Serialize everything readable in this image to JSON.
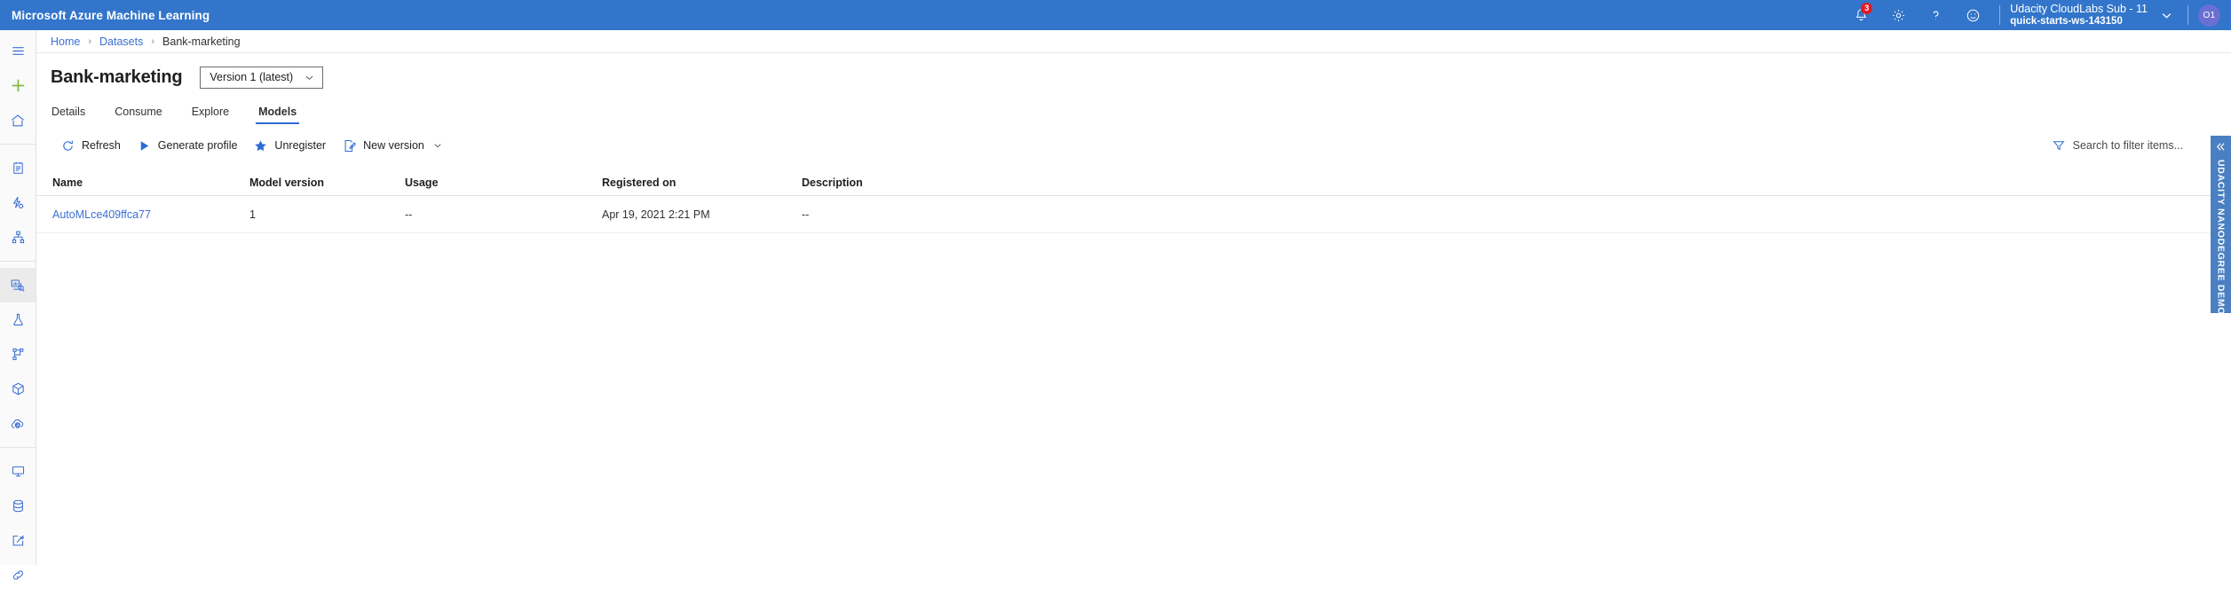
{
  "topbar": {
    "brand": "Microsoft Azure Machine Learning",
    "notifications_badge": "3",
    "icons": [
      "bell-icon",
      "gear-icon",
      "help-icon",
      "feedback-icon"
    ],
    "account": {
      "subscription": "Udacity CloudLabs Sub - 11",
      "workspace": "quick-starts-ws-143150",
      "avatar_initials": "O1"
    },
    "accent_color": "#3275ca"
  },
  "sidebar": {
    "groups": [
      {
        "items": [
          {
            "name": "hamburger-menu",
            "icon": "hamburger-icon",
            "selected": false
          },
          {
            "name": "new-item",
            "icon": "plus-icon",
            "selected": false
          },
          {
            "name": "home",
            "icon": "home-icon",
            "selected": false
          }
        ]
      },
      {
        "items": [
          {
            "name": "notebooks",
            "icon": "notebook-icon",
            "selected": false
          },
          {
            "name": "automated-ml",
            "icon": "automated-ml-icon",
            "selected": false
          },
          {
            "name": "designer",
            "icon": "designer-icon",
            "selected": false
          }
        ]
      },
      {
        "items": [
          {
            "name": "datasets",
            "icon": "datasets-icon",
            "selected": true
          },
          {
            "name": "experiments",
            "icon": "flask-icon",
            "selected": false
          },
          {
            "name": "pipelines",
            "icon": "pipeline-icon",
            "selected": false
          },
          {
            "name": "models",
            "icon": "cube-icon",
            "selected": false
          },
          {
            "name": "endpoints",
            "icon": "endpoint-cloud-icon",
            "selected": false
          }
        ]
      },
      {
        "items": [
          {
            "name": "compute",
            "icon": "monitor-icon",
            "selected": false
          },
          {
            "name": "datastores",
            "icon": "database-icon",
            "selected": false
          },
          {
            "name": "data-labeling",
            "icon": "labeling-icon",
            "selected": false
          },
          {
            "name": "linked-services",
            "icon": "link-icon",
            "selected": false
          }
        ]
      }
    ]
  },
  "breadcrumb": {
    "items": [
      {
        "label": "Home",
        "link": true
      },
      {
        "label": "Datasets",
        "link": true
      },
      {
        "label": "Bank-marketing",
        "link": false
      }
    ],
    "separator": "›"
  },
  "page": {
    "title": "Bank-marketing",
    "version_selector": "Version 1 (latest)"
  },
  "tabs": [
    {
      "label": "Details",
      "active": false
    },
    {
      "label": "Consume",
      "active": false
    },
    {
      "label": "Explore",
      "active": false
    },
    {
      "label": "Models",
      "active": true
    }
  ],
  "commandbar": {
    "buttons": [
      {
        "label": "Refresh",
        "icon": "refresh-icon",
        "dropdown": false
      },
      {
        "label": "Generate profile",
        "icon": "play-icon",
        "dropdown": false
      },
      {
        "label": "Unregister",
        "icon": "star-icon",
        "dropdown": false
      },
      {
        "label": "New version",
        "icon": "new-version-icon",
        "dropdown": true
      }
    ],
    "filter_placeholder": "Search to filter items..."
  },
  "table": {
    "columns": [
      "Name",
      "Model version",
      "Usage",
      "Registered on",
      "Description"
    ],
    "rows": [
      {
        "name": "AutoMLce409ffca77",
        "model_version": "1",
        "usage": "--",
        "registered_on": "Apr 19, 2021 2:21 PM",
        "description": "--"
      }
    ]
  },
  "demo_flag": {
    "label": "UDACITY NANODEGREE DEMO",
    "collapse_icon": "double-chevron-left-icon"
  }
}
